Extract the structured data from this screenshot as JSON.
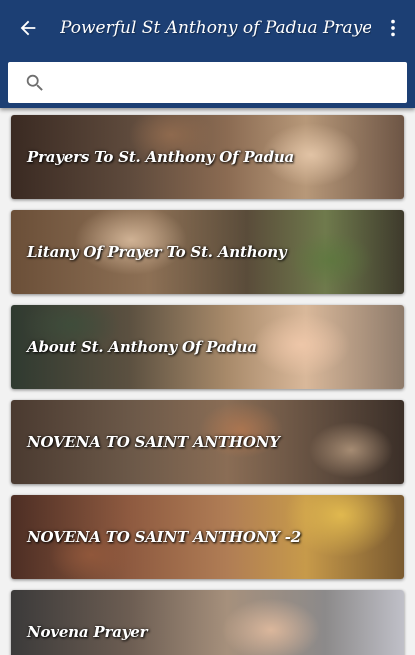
{
  "app_bar": {
    "title": "Powerful St Anthony of Padua Prayer",
    "back_icon": "arrow-back-icon",
    "menu_icon": "more-vert-icon",
    "color": "#1c3f74"
  },
  "search": {
    "icon": "search-icon",
    "placeholder": "",
    "value": ""
  },
  "items": [
    {
      "label": "Prayers To St. Anthony Of Padua"
    },
    {
      "label": "Litany Of Prayer To St. Anthony"
    },
    {
      "label": "About St. Anthony Of Padua"
    },
    {
      "label": "NOVENA TO SAINT ANTHONY"
    },
    {
      "label": "NOVENA TO SAINT ANTHONY -2"
    },
    {
      "label": "Novena Prayer"
    }
  ]
}
